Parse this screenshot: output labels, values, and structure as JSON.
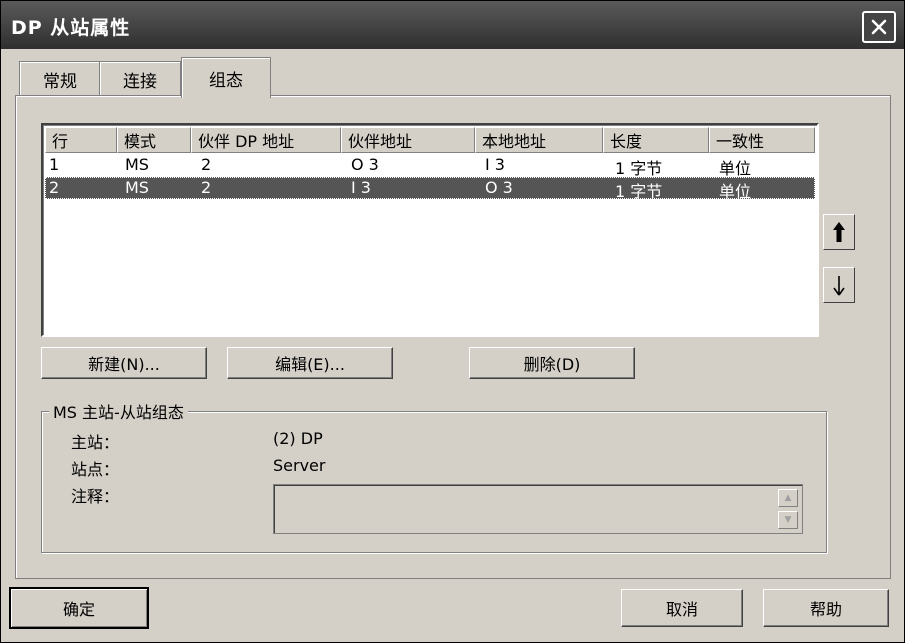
{
  "window": {
    "title": "DP 从站属性"
  },
  "tabs": [
    {
      "label": "常规"
    },
    {
      "label": "连接"
    },
    {
      "label": "组态",
      "active": true
    }
  ],
  "table": {
    "headers": [
      "行",
      "模式",
      "伙伴 DP 地址",
      "伙伴地址",
      "本地地址",
      "长度",
      "一致性"
    ],
    "rows": [
      {
        "line": "1",
        "mode": "MS",
        "partner_dp": "2",
        "partner_addr": "O 3",
        "local_addr": "I 3",
        "length": "1 字节",
        "consistency": "单位",
        "selected": false
      },
      {
        "line": "2",
        "mode": "MS",
        "partner_dp": "2",
        "partner_addr": "I 3",
        "local_addr": "O 3",
        "length": "1 字节",
        "consistency": "单位",
        "selected": true
      }
    ]
  },
  "buttons": {
    "new": "新建(N)...",
    "edit": "编辑(E)...",
    "delete": "删除(D)",
    "ok": "确定",
    "cancel": "取消",
    "help": "帮助"
  },
  "group": {
    "title": "MS 主站-从站组态",
    "master_label": "主站：",
    "master_value": "(2) DP",
    "station_label": "站点：",
    "station_value": "Server",
    "comment_label": "注释：",
    "comment_value": ""
  },
  "icons": {
    "close": "close-icon",
    "move_up": "arrow-up-icon",
    "move_down": "arrow-down-icon"
  }
}
